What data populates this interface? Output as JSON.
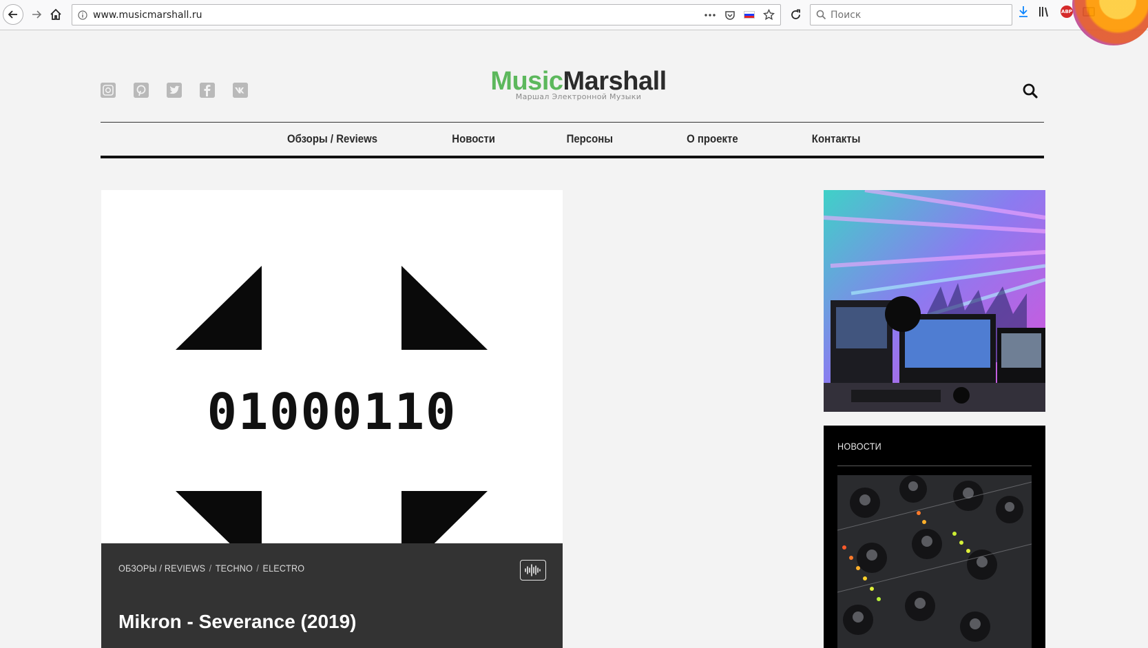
{
  "browser": {
    "url": "www.musicmarshall.ru",
    "search_placeholder": "Поиск",
    "abp_label": "ABP"
  },
  "social": {
    "instagram": "instagram-icon",
    "pinterest": "pinterest-icon",
    "twitter": "twitter-icon",
    "facebook": "facebook-icon",
    "vk": "vk-icon"
  },
  "logo": {
    "part1": "Music",
    "part2": "Marshall",
    "tagline": "Маршал Электронной Музыки",
    "colors": {
      "green": "#5cb85c",
      "dark": "#2b2b2b"
    }
  },
  "menu": {
    "items": [
      {
        "label": "Обзоры / Reviews"
      },
      {
        "label": "Новости"
      },
      {
        "label": "Персоны"
      },
      {
        "label": "О проекте"
      },
      {
        "label": "Контакты"
      }
    ]
  },
  "article": {
    "cover_text": "01000110",
    "categories": [
      "ОБЗОРЫ / REVIEWS",
      "TECHNO",
      "ELECTRO"
    ],
    "title": "Mikron - Severance (2019)",
    "format_icon": "audio-waveform-icon"
  },
  "sidebar": {
    "news_heading": "НОВОСТИ"
  }
}
